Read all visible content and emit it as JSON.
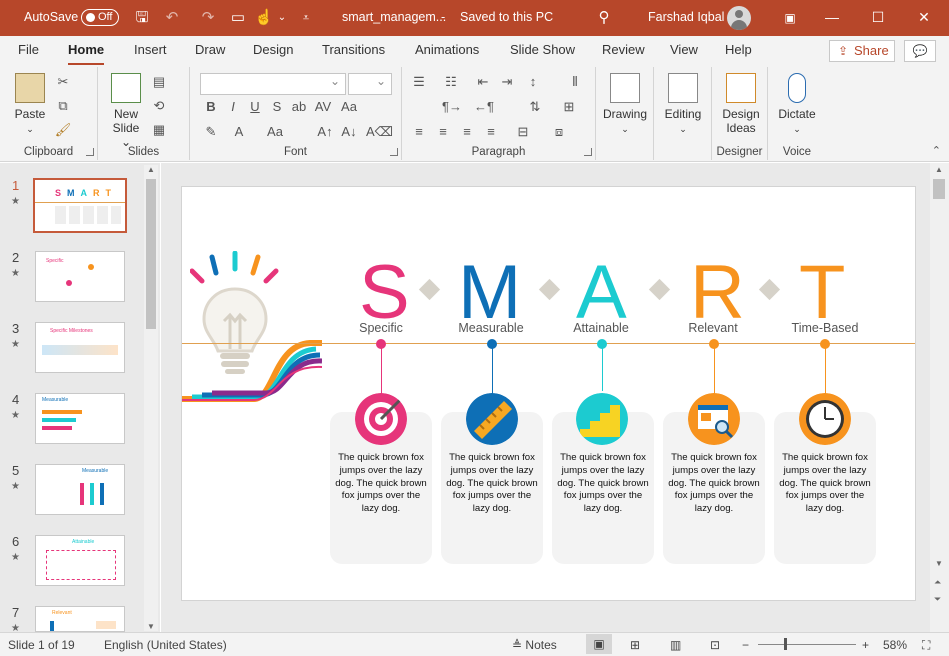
{
  "titlebar": {
    "autosave_label": "AutoSave",
    "autosave_state": "Off",
    "doc_title": "smart_managem...",
    "save_state": "Saved to this PC",
    "user_name": "Farshad Iqbal",
    "accent_color": "#b7472a"
  },
  "ribbon_tabs": [
    "File",
    "Home",
    "Insert",
    "Draw",
    "Design",
    "Transitions",
    "Animations",
    "Slide Show",
    "Review",
    "View",
    "Help"
  ],
  "active_tab": "Home",
  "share_label": "Share",
  "ribbon": {
    "clipboard": {
      "label": "Clipboard",
      "paste": "Paste"
    },
    "slides": {
      "label": "Slides",
      "new_slide_1": "New",
      "new_slide_2": "Slide"
    },
    "font": {
      "label": "Font"
    },
    "paragraph": {
      "label": "Paragraph"
    },
    "drawing": {
      "label": "Drawing"
    },
    "editing": {
      "label": "Editing"
    },
    "designer": {
      "label": "Designer",
      "design_ideas_1": "Design",
      "design_ideas_2": "Ideas"
    },
    "voice": {
      "label": "Voice",
      "dictate": "Dictate"
    }
  },
  "thumbnails": [
    {
      "num": "1",
      "selected": true
    },
    {
      "num": "2",
      "title": "Specific"
    },
    {
      "num": "3",
      "title": "Specific Milestones"
    },
    {
      "num": "4",
      "title": "Measurable"
    },
    {
      "num": "5",
      "title": "Measurable"
    },
    {
      "num": "6",
      "title": "Attainable"
    },
    {
      "num": "7",
      "title": "Relevant"
    }
  ],
  "slide": {
    "letters": [
      {
        "char": "S",
        "label": "Specific",
        "color": "#e6357a"
      },
      {
        "char": "M",
        "label": "Measurable",
        "color": "#0e6fb6"
      },
      {
        "char": "A",
        "label": "Attainable",
        "color": "#1ccbd0"
      },
      {
        "char": "R",
        "label": "Relevant",
        "color": "#f7931e"
      },
      {
        "char": "T",
        "label": "Time-Based",
        "color": "#f7931e"
      }
    ],
    "card_text": "The quick brown fox jumps over the lazy dog. The quick brown fox jumps over the lazy dog.",
    "icons": [
      "target-icon",
      "ruler-icon",
      "stairs-icon",
      "browser-search-icon",
      "clock-icon"
    ]
  },
  "status": {
    "slide_of": "Slide 1 of 19",
    "language": "English (United States)",
    "notes": "Notes",
    "zoom": "58%"
  }
}
